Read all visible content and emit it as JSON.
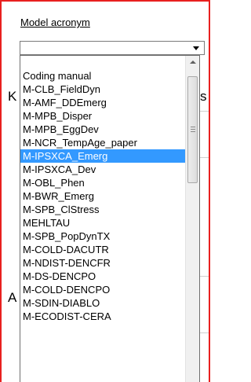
{
  "field": {
    "label": "Model acronym",
    "value": ""
  },
  "background": {
    "fragment_left_1": "K",
    "fragment_right_1": "s",
    "fragment_left_2": "A"
  },
  "dropdown": {
    "selected_index": 8,
    "options": [
      "Coding manual",
      "M-CLB_FieldDyn",
      "M-AMF_DDEmerg",
      "M-MPB_Disper",
      "M-MPB_EggDev",
      "M-NCR_TempAge_paper",
      "M-IPSXCA_Emerg",
      "M-IPSXCA_Dev",
      "M-OBL_Phen",
      "M-BWR_Emerg",
      "M-SPB_ClStress",
      "MEHLTAU",
      "M-SPB_PopDynTX",
      "M-COLD-DACUTR",
      "M-NDIST-DENCFR",
      "M-DS-DENCPO",
      "M-COLD-DENCPO",
      "M-SDIN-DIABLO",
      "M-ECODIST-CERA"
    ]
  },
  "colors": {
    "selection": "#3399ff",
    "frame_border": "#e8201f"
  }
}
